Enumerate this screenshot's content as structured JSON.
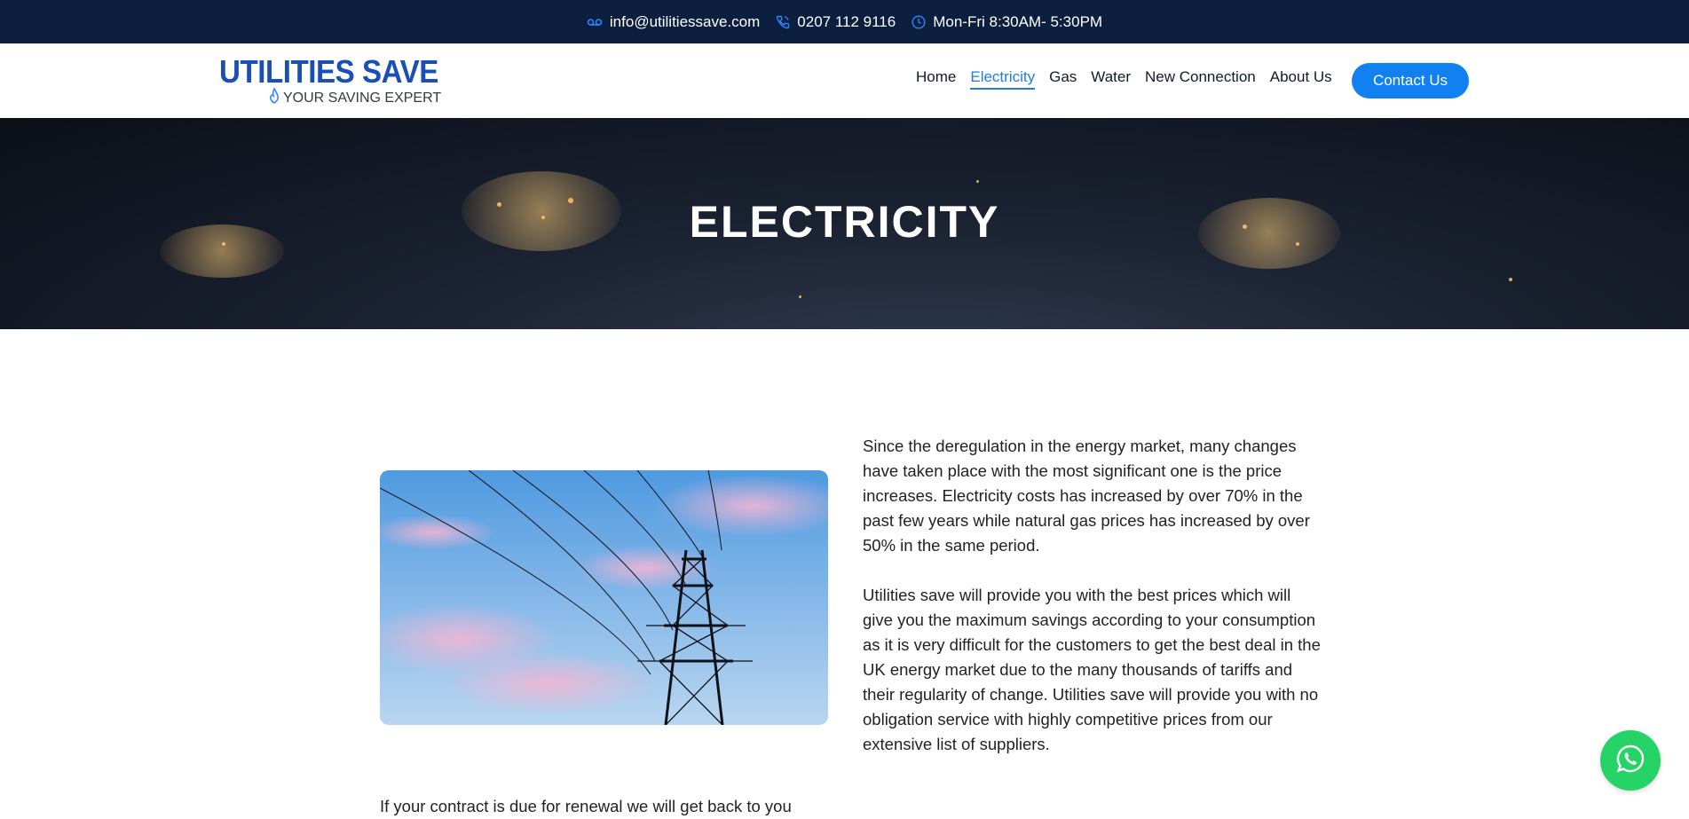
{
  "topbar": {
    "email": "info@utilitiessave.com",
    "phone": "0207 112 9116",
    "hours": "Mon-Fri 8:30AM- 5:30PM",
    "icons": [
      "voicemail-icon",
      "phone-icon",
      "clock-icon"
    ],
    "background": "#0c1f3f",
    "icon_color": "#2f86ff"
  },
  "brand": {
    "name": "UTILITIES SAVE",
    "tagline": "YOUR SAVING EXPERT",
    "color": "#1a4fb5"
  },
  "nav": {
    "items": [
      "Home",
      "Electricity",
      "Gas",
      "Water",
      "New Connection",
      "About Us"
    ],
    "active": "Electricity",
    "contact_label": "Contact Us",
    "accent": "#1180f0"
  },
  "hero": {
    "title": "ELECTRICITY"
  },
  "content": {
    "paragraph1": "Since the deregulation in the energy market, many changes have taken place with the most significant one is the price increases. Electricity costs has increased by over 70% in the past few years while natural gas prices has increased by over 50% in the same period.",
    "paragraph2": "Utilities save will provide you with the best prices which will give you the maximum savings according to your consumption as it is very difficult for the customers to get the best deal in the UK energy market due to the many thousands of tariffs and their regularity of change. Utilities save will provide you with no obligation service with highly competitive prices from our extensive list of suppliers.",
    "paragraph3": "If your contract is due for renewal we will get back to you"
  },
  "floating": {
    "icon": "whatsapp-icon",
    "color": "#25d366"
  }
}
